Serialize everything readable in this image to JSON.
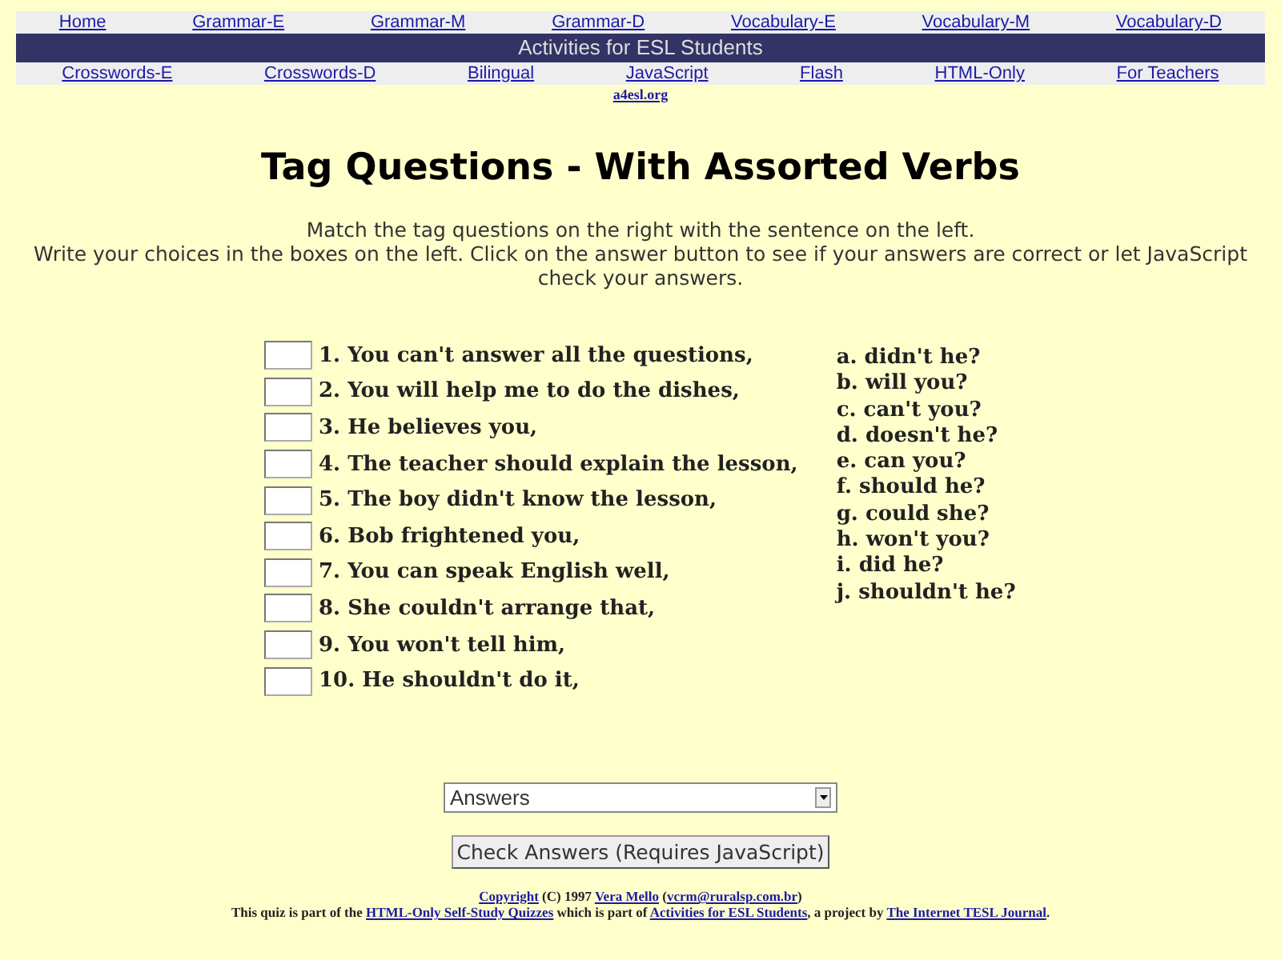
{
  "nav_top": [
    "Home",
    "Grammar-E",
    "Grammar-M",
    "Grammar-D",
    "Vocabulary-E",
    "Vocabulary-M",
    "Vocabulary-D"
  ],
  "banner": "Activities for ESL Students",
  "nav_bottom": [
    "Crosswords-E",
    "Crosswords-D",
    "Bilingual",
    "JavaScript",
    "Flash",
    "HTML-Only",
    "For Teachers"
  ],
  "site_link": "a4esl.org",
  "title": "Tag Questions - With Assorted Verbs",
  "instructions": [
    "Match the tag questions on the right with the sentence on the left.",
    "Write your choices in the boxes on the left. Click on the answer button to see if your answers are correct or let JavaScript check your answers."
  ],
  "questions": [
    "1. You can't answer all the questions,",
    "2. You will help me to do the dishes,",
    "3. He believes you,",
    "4. The teacher should explain the lesson,",
    "5. The boy didn't know the lesson,",
    "6. Bob frightened you,",
    "7. You can speak English well,",
    "8. She couldn't arrange that,",
    "9. You won't tell him,",
    "10. He shouldn't do it,"
  ],
  "tags": [
    "a. didn't he?",
    "b. will you?",
    "c. can't you?",
    "d. doesn't he?",
    "e. can you?",
    "f. should he?",
    "g. could she?",
    "h. won't you?",
    "i. did he?",
    "j. shouldn't he?"
  ],
  "answers_dropdown": {
    "value": "Answers"
  },
  "check_button": "Check Answers (Requires JavaScript)",
  "footer": [
    [
      {
        "text": "Copyright",
        "link": true
      },
      {
        "text": " (C) 1997 ",
        "link": false
      },
      {
        "text": "Vera Mello",
        "link": true
      },
      {
        "text": " (",
        "link": false
      },
      {
        "text": "vcrm@ruralsp.com.br",
        "link": true
      },
      {
        "text": ")",
        "link": false
      }
    ],
    [
      {
        "text": "This quiz is part of the ",
        "link": false
      },
      {
        "text": "HTML-Only Self-Study Quizzes",
        "link": true
      },
      {
        "text": " which is part of ",
        "link": false
      },
      {
        "text": "Activities for ESL Students",
        "link": true
      },
      {
        "text": ", a project by ",
        "link": false
      },
      {
        "text": "The Internet TESL Journal",
        "link": true
      },
      {
        "text": ".",
        "link": false
      }
    ]
  ]
}
